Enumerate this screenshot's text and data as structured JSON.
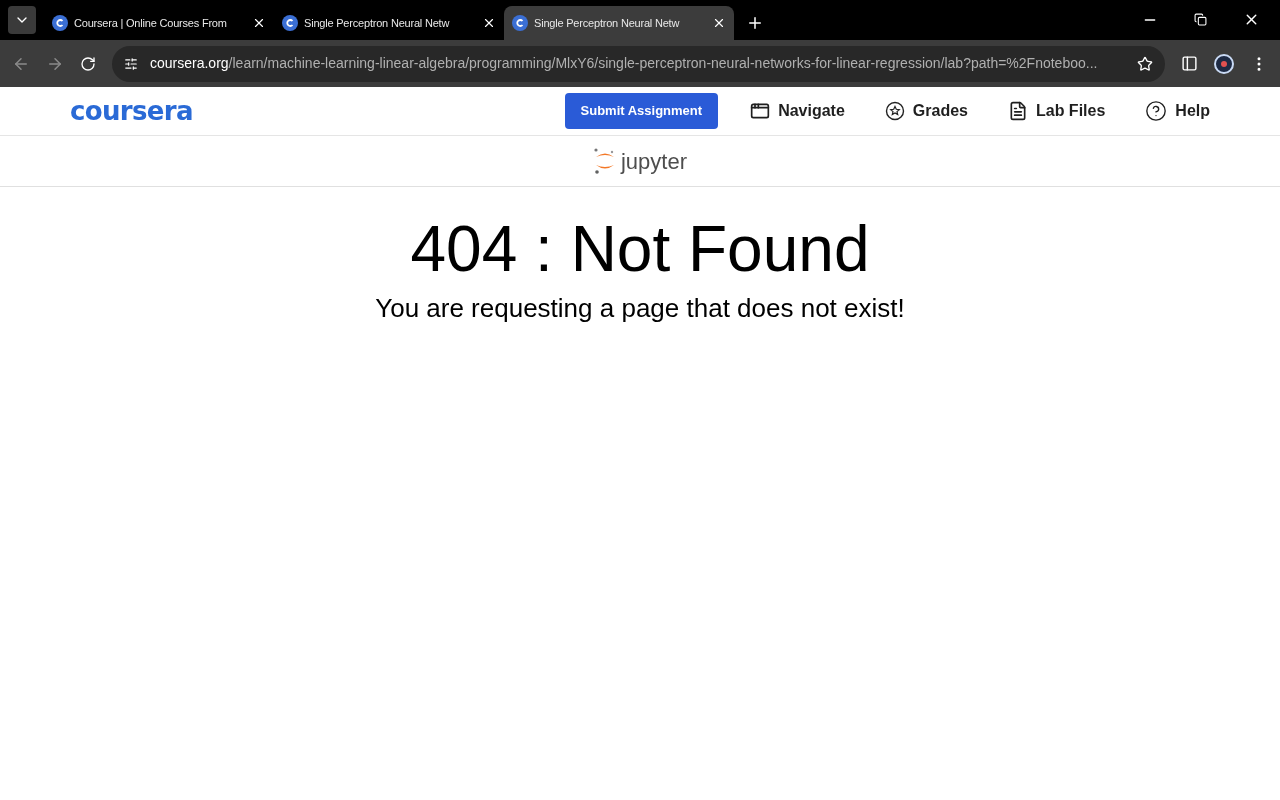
{
  "browser": {
    "tabs": [
      {
        "title": "Coursera | Online Courses From",
        "selected": false
      },
      {
        "title": "Single Perceptron Neural Netw",
        "selected": false
      },
      {
        "title": "Single Perceptron Neural Netw",
        "selected": true
      }
    ],
    "url": {
      "host": "coursera.org",
      "path": "/learn/machine-learning-linear-algebra/programming/MlxY6/single-perceptron-neural-networks-for-linear-regression/lab?path=%2Fnoteboo..."
    }
  },
  "header": {
    "logo": "coursera",
    "submit": "Submit Assignment",
    "nav": [
      {
        "kind": "navigate",
        "label": "Navigate"
      },
      {
        "kind": "grades",
        "label": "Grades"
      },
      {
        "kind": "files",
        "label": "Lab Files"
      },
      {
        "kind": "help",
        "label": "Help"
      }
    ]
  },
  "jupyter": {
    "logo": "jupyter"
  },
  "error": {
    "title": "404 : Not Found",
    "message": "You are requesting a page that does not exist!"
  }
}
